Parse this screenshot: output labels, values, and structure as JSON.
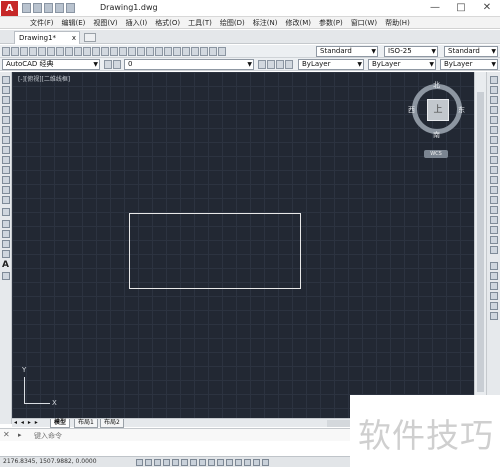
{
  "window": {
    "title": "Drawing1.dwg",
    "logo": "A",
    "minimize": "—",
    "maximize": "□",
    "close": "✕"
  },
  "menu": [
    "文件(F)",
    "编辑(E)",
    "视图(V)",
    "插入(I)",
    "格式(O)",
    "工具(T)",
    "绘图(D)",
    "标注(N)",
    "修改(M)",
    "参数(P)",
    "窗口(W)",
    "帮助(H)"
  ],
  "tabs": {
    "document": "Drawing1*",
    "close": "x"
  },
  "toolbar": {
    "text_style": "Standard",
    "dim_style": "ISO-25",
    "table_style": "Standard",
    "workspace": "AutoCAD 经典",
    "layer": "0",
    "color": "ByLayer",
    "linetype": "ByLayer",
    "lineweight": "ByLayer"
  },
  "viewport": {
    "label": "[-][俯视][二维线框]"
  },
  "viewcube": {
    "north": "北",
    "south": "南",
    "east": "东",
    "west": "西",
    "top": "上",
    "wcs": "WCS"
  },
  "ucs": {
    "y": "Y",
    "x": "X"
  },
  "layout_tabs": {
    "arrows": "◂ ◂ ▸ ▸",
    "model": "模型",
    "layout1": "布局1",
    "layout2": "布局2"
  },
  "command": {
    "close": "✕",
    "prompt": "键入命令"
  },
  "status": {
    "coords": "2176.8345, 1507.9882, 0.0000"
  },
  "watermark": "软件技巧",
  "colors": {
    "canvas": "#222833",
    "logo": "#c62828"
  }
}
